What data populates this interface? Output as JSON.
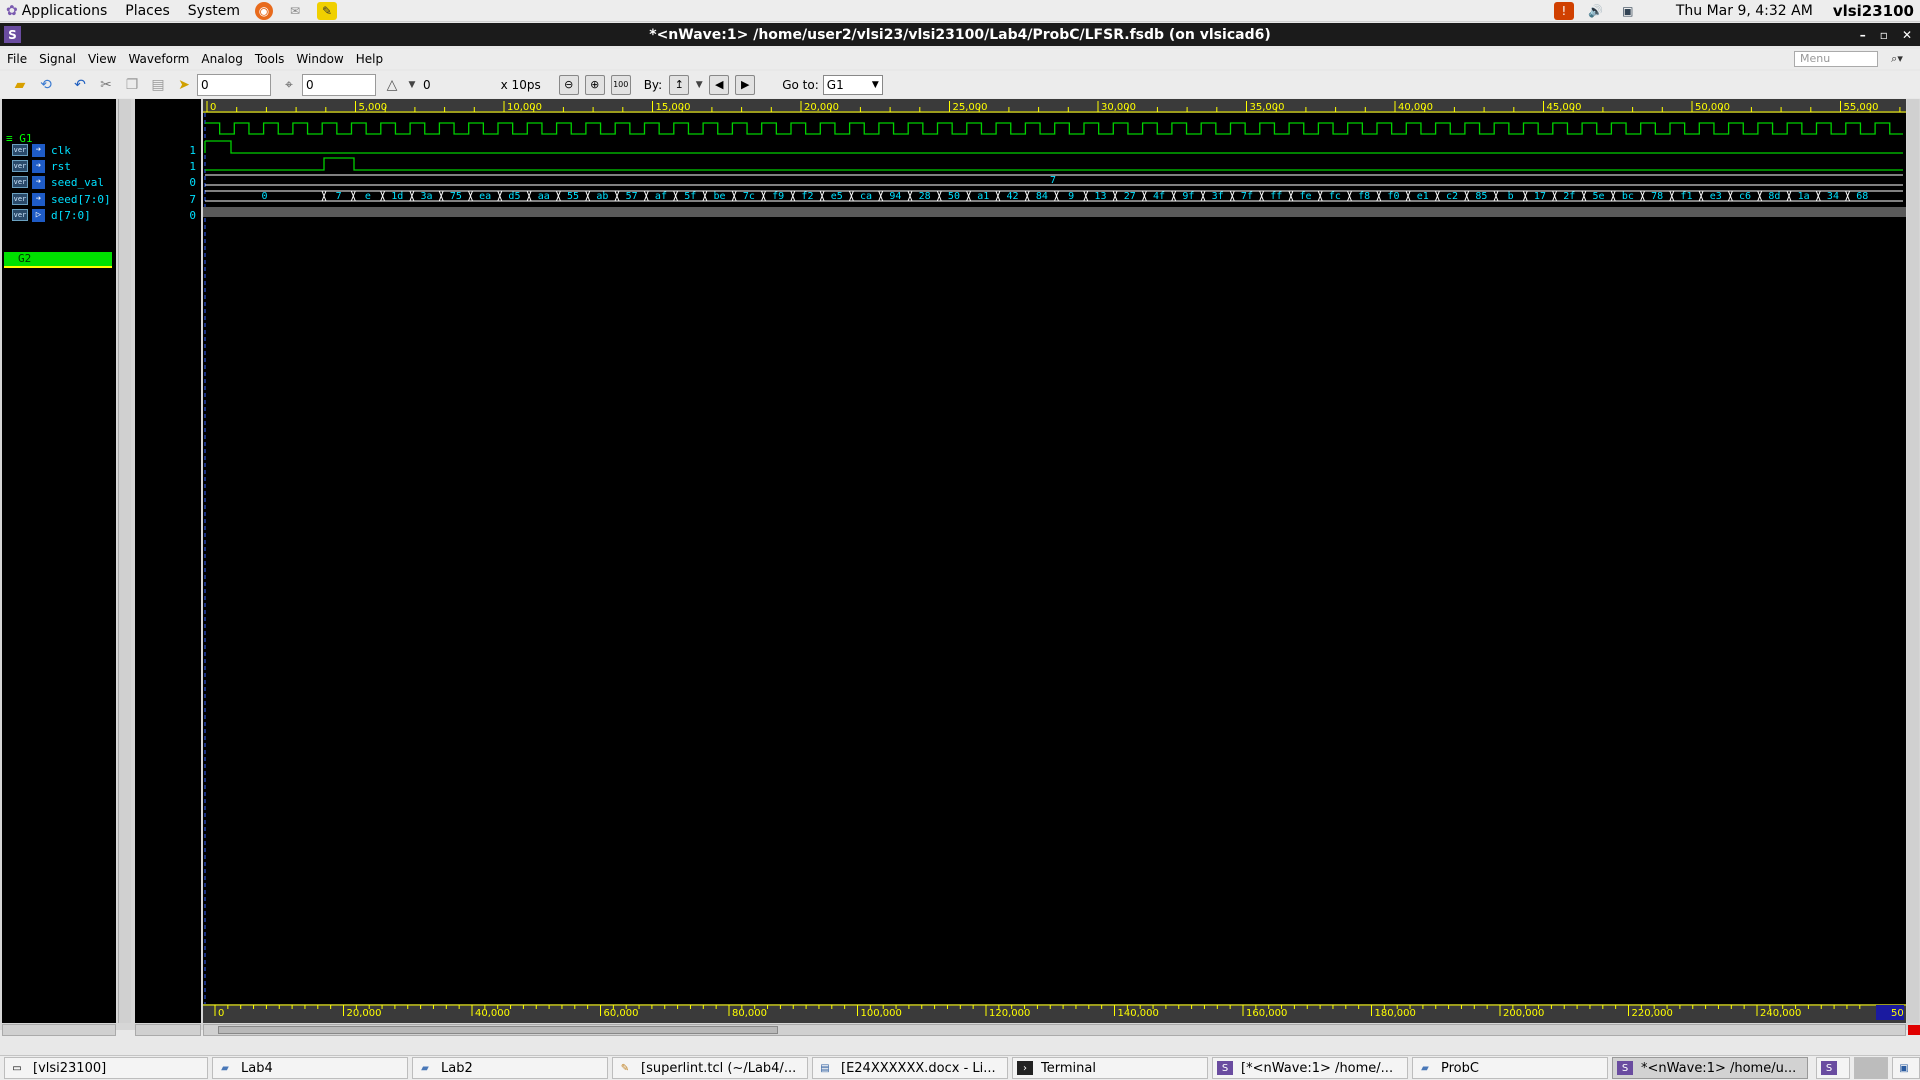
{
  "top_panel": {
    "menus": [
      "Applications",
      "Places",
      "System"
    ],
    "clock": "Thu Mar  9,  4:32 AM",
    "user": "vlsi23100"
  },
  "window": {
    "title": "*<nWave:1> /home/user2/vlsi23/vlsi23100/Lab4/ProbC/LFSR.fsdb (on vlsicad6)",
    "logo": "S",
    "controls": [
      "–",
      "▫",
      "✕"
    ]
  },
  "menubar": {
    "items": [
      "File",
      "Signal",
      "View",
      "Waveform",
      "Analog",
      "Tools",
      "Window",
      "Help"
    ],
    "search_placeholder": "Menu"
  },
  "toolbar": {
    "cursor_time": "0",
    "marker_time": "0",
    "delta_value": "0",
    "time_unit": "x 10ps",
    "by_label": "By:",
    "goto_label": "Go to:",
    "goto_value": "G1"
  },
  "signals": {
    "group1": "≡ G1",
    "group2": "G2",
    "badge": "ver",
    "rows": [
      {
        "name": "clk",
        "value": "1"
      },
      {
        "name": "rst",
        "value": "1"
      },
      {
        "name": "seed_val",
        "value": "0"
      },
      {
        "name": "seed[7:0]",
        "value": "7"
      },
      {
        "name": "d[7:0]",
        "value": "0"
      }
    ]
  },
  "timeline": {
    "top_ticks": [
      "0",
      "5,000",
      "10,000",
      "15,000",
      "20,000",
      "25,000",
      "30,000",
      "35,000",
      "40,000",
      "45,000",
      "50,000",
      "55,000"
    ],
    "bottom_ticks": [
      "0",
      "20,000",
      "40,000",
      "60,000",
      "80,000",
      "100,000",
      "120,000",
      "140,000",
      "160,000",
      "180,000",
      "200,000",
      "220,000",
      "240,000"
    ],
    "bottom_end": "50"
  },
  "waveform": {
    "seed_bus_value": "7",
    "d_bus_first": "0",
    "d_bus_values": [
      "7",
      "e",
      "1d",
      "3a",
      "75",
      "ea",
      "d5",
      "aa",
      "55",
      "ab",
      "57",
      "af",
      "5f",
      "be",
      "7c",
      "f9",
      "f2",
      "e5",
      "ca",
      "94",
      "28",
      "50",
      "a1",
      "42",
      "84",
      "9",
      "13",
      "27",
      "4f",
      "9f",
      "3f",
      "7f",
      "ff",
      "fe",
      "fc",
      "f8",
      "f0",
      "e1",
      "c2",
      "85",
      "b",
      "17",
      "2f",
      "5e",
      "bc",
      "78",
      "f1",
      "e3",
      "c6",
      "8d",
      "1a",
      "34",
      "68"
    ],
    "colors": {
      "wave": "#00d000",
      "bus_text": "#00e0ff",
      "ruler": "#ffff00",
      "bus_line": "#ffffff"
    }
  },
  "taskbar": {
    "tasks": [
      "[vlsi23100]",
      "Lab4",
      "Lab2",
      "[superlint.tcl (~/Lab4/...",
      "[E24XXXXXX.docx - Li...",
      "Terminal",
      "[*<nWave:1> /home/...",
      "ProbC",
      "*<nWave:1> /home/u..."
    ]
  }
}
